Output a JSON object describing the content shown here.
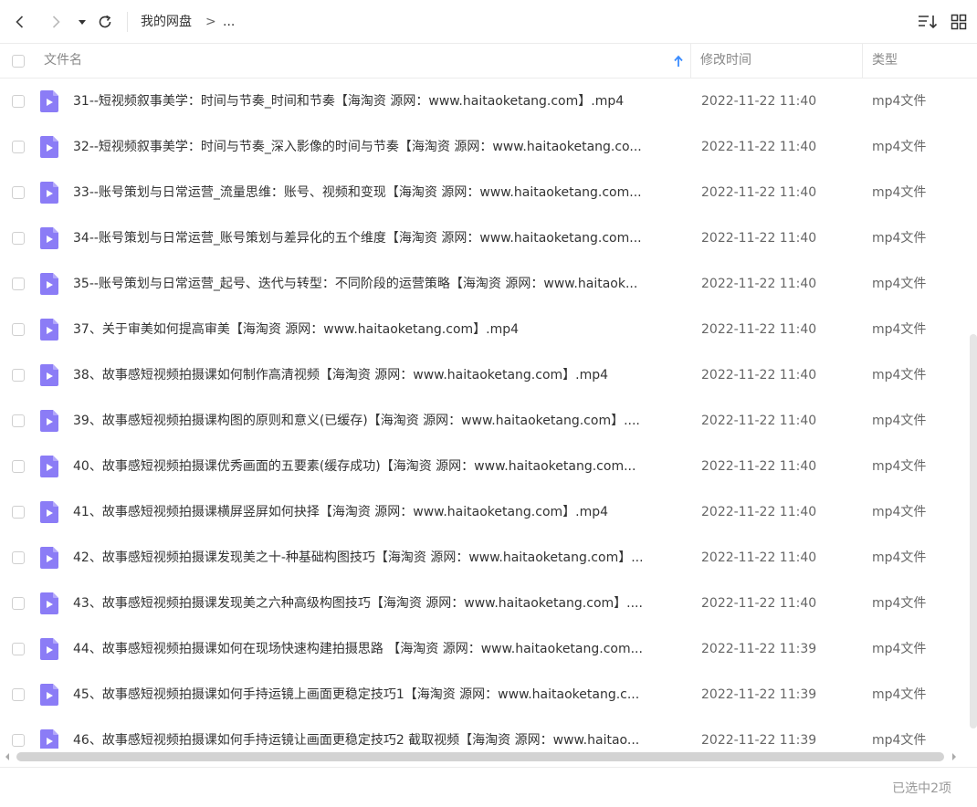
{
  "toolbar": {
    "back_icon": "chevron-left-icon",
    "forward_icon": "chevron-right-icon",
    "history_icon": "caret-down-icon",
    "refresh_icon": "refresh-icon",
    "breadcrumb_root": "我的网盘",
    "breadcrumb_sep": ">",
    "breadcrumb_more": "...",
    "sort_icon": "sort-icon",
    "grid_icon": "grid-view-icon"
  },
  "columns": {
    "name": "文件名",
    "modified": "修改时间",
    "type": "类型",
    "sort_icon": "arrow-up-icon"
  },
  "files": [
    {
      "name": "31--短视频叙事美学：时间与节奏_时间和节奏【海淘资 源网：www.haitaoketang.com】.mp4",
      "modified": "2022-11-22 11:40",
      "type": "mp4文件"
    },
    {
      "name": "32--短视频叙事美学：时间与节奏_深入影像的时间与节奏【海淘资 源网：www.haitaoketang.co...",
      "modified": "2022-11-22 11:40",
      "type": "mp4文件"
    },
    {
      "name": "33--账号策划与日常运营_流量思维：账号、视频和变现【海淘资 源网：www.haitaoketang.com...",
      "modified": "2022-11-22 11:40",
      "type": "mp4文件"
    },
    {
      "name": "34--账号策划与日常运营_账号策划与差异化的五个维度【海淘资 源网：www.haitaoketang.com...",
      "modified": "2022-11-22 11:40",
      "type": "mp4文件"
    },
    {
      "name": "35--账号策划与日常运营_起号、迭代与转型：不同阶段的运营策略【海淘资 源网：www.haitaok...",
      "modified": "2022-11-22 11:40",
      "type": "mp4文件"
    },
    {
      "name": "37、关于审美如何提高审美【海淘资 源网：www.haitaoketang.com】.mp4",
      "modified": "2022-11-22 11:40",
      "type": "mp4文件"
    },
    {
      "name": "38、故事感短视频拍摄课如何制作高清视频【海淘资 源网：www.haitaoketang.com】.mp4",
      "modified": "2022-11-22 11:40",
      "type": "mp4文件"
    },
    {
      "name": "39、故事感短视频拍摄课构图的原则和意义(已缓存)【海淘资 源网：www.haitaoketang.com】....",
      "modified": "2022-11-22 11:40",
      "type": "mp4文件"
    },
    {
      "name": "40、故事感短视频拍摄课优秀画面的五要素(缓存成功)【海淘资 源网：www.haitaoketang.com...",
      "modified": "2022-11-22 11:40",
      "type": "mp4文件"
    },
    {
      "name": "41、故事感短视频拍摄课横屏竖屏如何抉择【海淘资 源网：www.haitaoketang.com】.mp4",
      "modified": "2022-11-22 11:40",
      "type": "mp4文件"
    },
    {
      "name": "42、故事感短视频拍摄课发现美之十-种基础构图技巧【海淘资 源网：www.haitaoketang.com】...",
      "modified": "2022-11-22 11:40",
      "type": "mp4文件"
    },
    {
      "name": "43、故事感短视频拍摄课发现美之六种高级构图技巧【海淘资 源网：www.haitaoketang.com】....",
      "modified": "2022-11-22 11:40",
      "type": "mp4文件"
    },
    {
      "name": "44、故事感短视频拍摄课如何在现场快速构建拍摄思路 【海淘资 源网：www.haitaoketang.com...",
      "modified": "2022-11-22 11:39",
      "type": "mp4文件"
    },
    {
      "name": "45、故事感短视频拍摄课如何手持运镜上画面更稳定技巧1【海淘资 源网：www.haitaoketang.c...",
      "modified": "2022-11-22 11:39",
      "type": "mp4文件"
    },
    {
      "name": "46、故事感短视频拍摄课如何手持运镜让画面更稳定技巧2 截取视频【海淘资 源网：www.haitao...",
      "modified": "2022-11-22 11:39",
      "type": "mp4文件"
    }
  ],
  "file_icon": "video-file-icon",
  "footer": {
    "selection": "已选中2项"
  },
  "colors": {
    "file_icon": "#8b7cf6",
    "accent": "#3b8cff"
  }
}
